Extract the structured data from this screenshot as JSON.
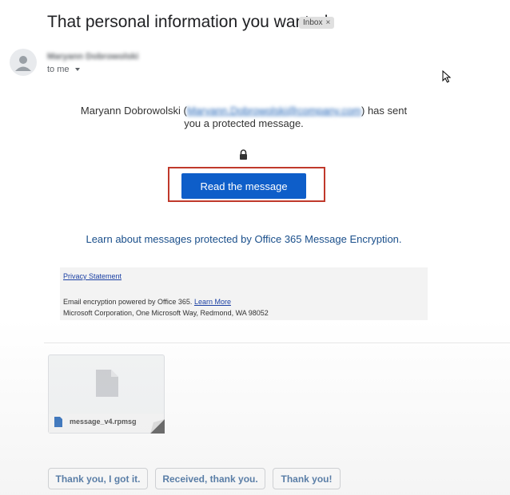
{
  "email": {
    "subject": "That personal information you wanted",
    "label_chip": "Inbox",
    "label_close": "×",
    "sender_name": "Maryann Dobrowolski",
    "recipient": "to me"
  },
  "body": {
    "sent_prefix": "Maryann Dobrowolski (",
    "sender_email": "Maryann.Dobrowolski@company.com",
    "sent_suffix": ") has sent you a protected message.",
    "read_button": "Read the message",
    "learn_link": "Learn about messages protected by Office 365 Message Encryption."
  },
  "footer": {
    "privacy": "Privacy Statement",
    "encryption_text": "Email encryption powered by Office 365.",
    "learn_more": "Learn More",
    "address": "Microsoft Corporation, One Microsoft Way, Redmond, WA 98052"
  },
  "attachment": {
    "filename": "message_v4.rpmsg"
  },
  "smart_replies": [
    "Thank you, I got it.",
    "Received, thank you.",
    "Thank you!"
  ],
  "colors": {
    "button_blue": "#0e5ec9",
    "highlight_red": "#c0392b",
    "link_blue": "#1a4f8b"
  }
}
